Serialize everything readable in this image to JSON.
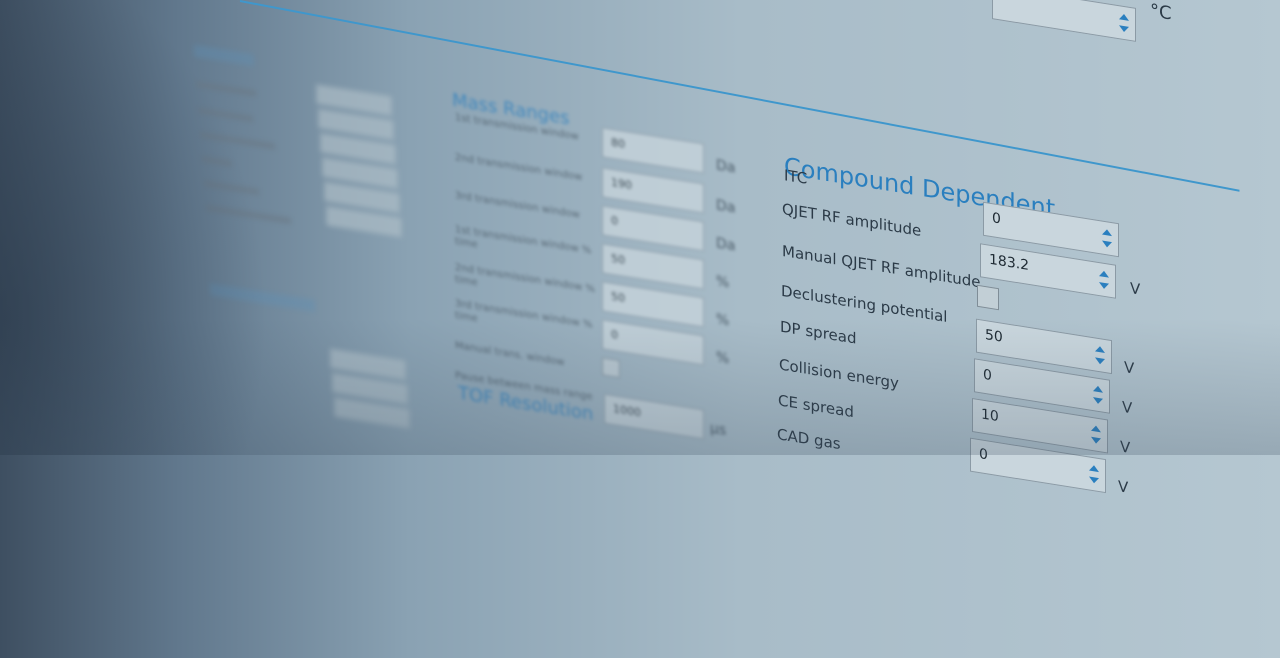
{
  "top": {
    "temp_unit": "°C"
  },
  "mass_ranges": {
    "title": "Mass Ranges",
    "rows": [
      {
        "label": "1st transmission window",
        "value": "80",
        "unit": "Da",
        "type": "text"
      },
      {
        "label": "2nd transmission window",
        "value": "190",
        "unit": "Da",
        "type": "text"
      },
      {
        "label": "3rd transmission window",
        "value": "0",
        "unit": "Da",
        "type": "text"
      },
      {
        "label": "1st transmission window % time",
        "value": "50",
        "unit": "%",
        "type": "text"
      },
      {
        "label": "2nd transmission window % time",
        "value": "50",
        "unit": "%",
        "type": "text"
      },
      {
        "label": "3rd transmission window % time",
        "value": "0",
        "unit": "%",
        "type": "text"
      },
      {
        "label": "Manual trans. window",
        "value": "",
        "unit": "",
        "type": "checkbox"
      },
      {
        "label": "Pause between mass range",
        "value": "1000",
        "unit": "µs",
        "type": "text"
      }
    ]
  },
  "tof_resolution": {
    "title": "TOF Resolution"
  },
  "compound_dependent": {
    "title": "Compound Dependent",
    "rows": [
      {
        "label": "ITC",
        "value": "",
        "unit": "",
        "type": "none"
      },
      {
        "label": "QJET RF amplitude",
        "value": "0",
        "unit": "",
        "type": "spin"
      },
      {
        "label": "Manual QJET RF amplitude",
        "value": "183.2",
        "unit": "V",
        "type": "spin"
      },
      {
        "label": "Declustering potential",
        "value": "",
        "unit": "",
        "type": "checkbox"
      },
      {
        "label": "DP spread",
        "value": "50",
        "unit": "V",
        "type": "spin"
      },
      {
        "label": "Collision energy",
        "value": "0",
        "unit": "V",
        "type": "spin"
      },
      {
        "label": "CE spread",
        "value": "10",
        "unit": "V",
        "type": "spin"
      },
      {
        "label": "CAD gas",
        "value": "0",
        "unit": "V",
        "type": "spin"
      }
    ]
  }
}
